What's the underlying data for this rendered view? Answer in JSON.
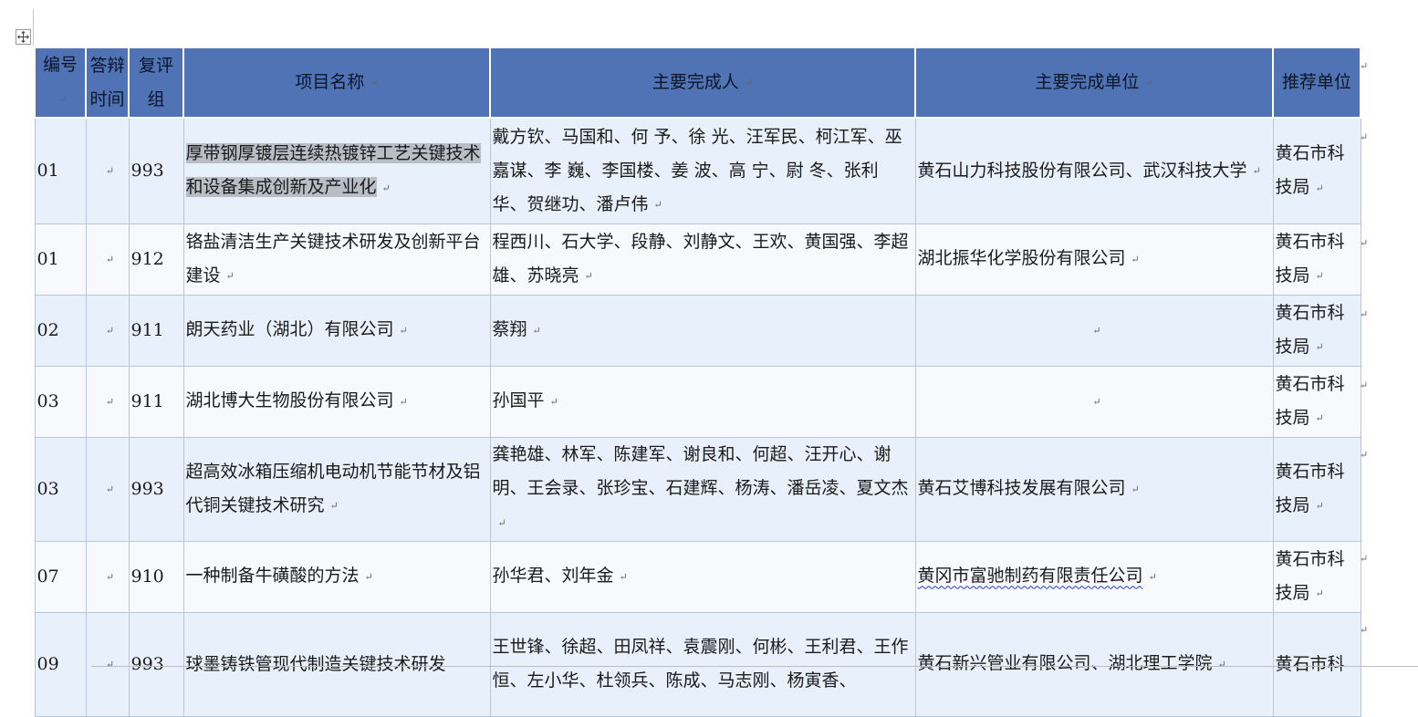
{
  "table": {
    "headers": [
      "编号",
      "答辩时间",
      "复评组",
      "项目名称",
      "主要完成人",
      "主要完成单位",
      "推荐单位"
    ],
    "rows": [
      {
        "no": "01",
        "time": "",
        "group": "993",
        "project": "厚带钢厚镀层连续热镀锌工艺关键技术和设备集成创新及产业化",
        "persons": "戴方钦、马国和、何 予、徐 光、汪军民、柯江军、巫嘉谋、李 巍、李国楼、姜 波、高 宁、尉 冬、张利华、贺继功、潘卢伟",
        "unit": "黄石山力科技股份有限公司、武汉科技大学",
        "recommender": "黄石市科技局"
      },
      {
        "no": "01",
        "time": "",
        "group": "912",
        "project": "铬盐清洁生产关键技术研发及创新平台建设",
        "persons": "程西川、石大学、段静、刘静文、王欢、黄国强、李超雄、苏晓亮",
        "unit": "湖北振华化学股份有限公司",
        "recommender": "黄石市科技局"
      },
      {
        "no": "02",
        "time": "",
        "group": "911",
        "project": "朗天药业（湖北）有限公司",
        "persons": "蔡翔",
        "unit": "",
        "recommender": "黄石市科技局"
      },
      {
        "no": "03",
        "time": "",
        "group": "911",
        "project": "湖北博大生物股份有限公司",
        "persons": "孙国平",
        "unit": "",
        "recommender": "黄石市科技局"
      },
      {
        "no": "03",
        "time": "",
        "group": "993",
        "project": "超高效冰箱压缩机电动机节能节材及铝代铜关键技术研究",
        "persons": "龚艳雄、林军、陈建军、谢良和、何超、汪开心、谢明、王会录、张珍宝、石建辉、杨涛、潘岳凌、夏文杰",
        "unit": "黄石艾博科技发展有限公司",
        "recommender": "黄石市科技局"
      },
      {
        "no": "07",
        "time": "",
        "group": "910",
        "project": "一种制备牛磺酸的方法",
        "persons": "孙华君、刘年金",
        "unit": "黄冈市富驰制药有限责任公司",
        "recommender": "黄石市科技局"
      },
      {
        "no": "09",
        "time": "",
        "group": "993",
        "project": "球墨铸铁管现代制造关键技术研发",
        "persons": "王世锋、徐超、田凤祥、袁震刚、何彬、王利君、王作恒、左小华、杜领兵、陈成、马志刚、杨寅香、",
        "unit": "黄石新兴管业有限公司、湖北理工学院",
        "recommender": "黄石市科"
      }
    ]
  },
  "marks": {
    "cell_end": "↵",
    "row_end": "↵"
  }
}
